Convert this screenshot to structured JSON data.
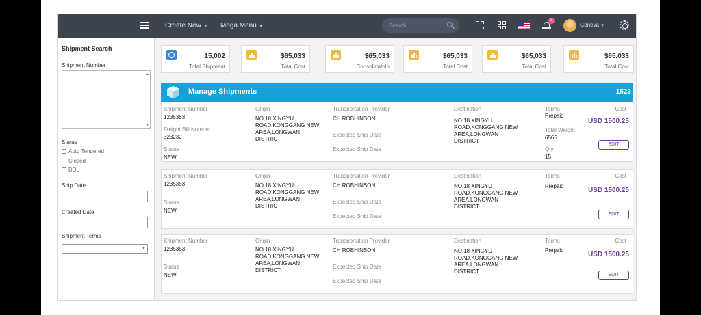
{
  "topbar": {
    "menu": [
      {
        "label": "Create New"
      },
      {
        "label": "Mega Menu"
      }
    ],
    "search_placeholder": "Search...",
    "notification_count": "3",
    "username": "Geneva"
  },
  "sidebar": {
    "title": "Shipment Search",
    "shipment_number_label": "Shipment Number",
    "status_label": "Status",
    "status_options": [
      "Auto Tendered",
      "Closed",
      "BOL"
    ],
    "ship_date_label": "Ship Date",
    "created_date_label": "Created Date",
    "shipment_terms_label": "Shipment Terms"
  },
  "stats": [
    {
      "value": "15,002",
      "label": "Total Shipment",
      "icon": "globe-icon",
      "color": "#3b87d6"
    },
    {
      "value": "$65,033",
      "label": "Total Cost",
      "icon": "bar-chart-icon",
      "color": "#f2b845"
    },
    {
      "value": "$65,033",
      "label": "Consolidatoin",
      "icon": "bar-chart-icon",
      "color": "#f2b845"
    },
    {
      "value": "$65,033",
      "label": "Total Cost",
      "icon": "bar-chart-icon",
      "color": "#f2b845"
    },
    {
      "value": "$65,033",
      "label": "Total Cost",
      "icon": "bar-chart-icon",
      "color": "#f2b845"
    },
    {
      "value": "$65,033",
      "label": "Total Cost",
      "icon": "bar-chart-icon",
      "color": "#f2b845"
    }
  ],
  "manage": {
    "title": "Manage Shipments",
    "count": "1523",
    "color": "#1aa0d8"
  },
  "labels": {
    "shipment_number": "Shipment Number",
    "origin": "Origin",
    "transportation_provider": "Transportation Provider",
    "destination": "Destination",
    "terms": "Terms",
    "cost": "Cost",
    "freight_bill_number": "Freight Bill Number",
    "status": "Status",
    "expected_ship_date": "Expected Ship Date",
    "total_weight": "Total Weight",
    "qty": "Qty",
    "edit": "EDIT"
  },
  "shipments": [
    {
      "shipment_number": "1235353",
      "freight_bill_number": "323232",
      "status": "NEW",
      "origin": "NO.18 XINGYU ROAD,KONGGANG NEW AREA,LONGWAN DISTRICT",
      "provider": "CH ROBHINSON",
      "destination": "NO.18 XINGYU ROAD,KONGGANG NEW AREA,LONGWAN DISTRICT",
      "terms": "Prepaid",
      "total_weight": "6565",
      "qty": "15",
      "cost": "USD 1500.25"
    },
    {
      "shipment_number": "1235353",
      "status": "NEW",
      "origin": "NO.18 XINGYU ROAD,KONGGANG NEW AREA,LONGWAN DISTRICT",
      "provider": "CH ROBHINSON",
      "destination": "NO.18 XINGYU ROAD,KONGGANG NEW AREA,LONGWAN DISTRICT",
      "terms": "Prepaid",
      "cost": "USD 1500.25"
    },
    {
      "shipment_number": "1235353",
      "status": "NEW",
      "origin": "NO.18 XINGYU ROAD,KONGGANG NEW AREA,LONGWAN DISTRICT",
      "provider": "CH ROBHINSON",
      "destination": "NO.18 XINGYU ROAD,KONGGANG NEW AREA,LONGWAN DISTRICT",
      "terms": "Prepaid",
      "cost": "USD 1500.25"
    }
  ],
  "colors": {
    "topbar": "#3d4450",
    "cost": "#6a3aa0"
  }
}
